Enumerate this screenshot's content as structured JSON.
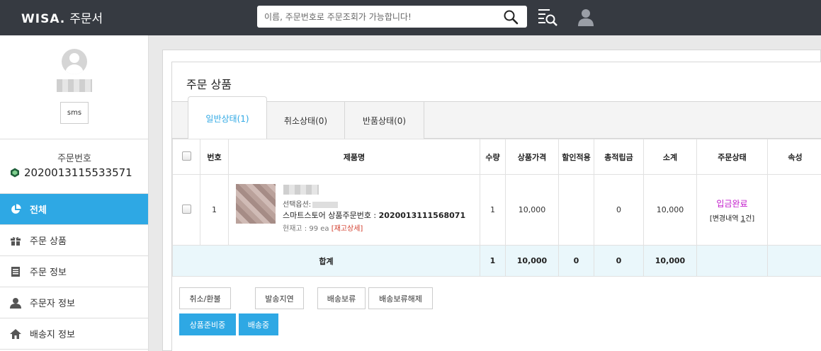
{
  "header": {
    "brand": "WISA.",
    "title": "주문서",
    "search_placeholder": "이름, 주문번호로 주문조회가 가능합니다!"
  },
  "sidebar": {
    "sms_label": "sms",
    "order_label": "주문번호",
    "order_number": "2020013115533571",
    "menu": [
      {
        "label": "전체",
        "icon": "pie-chart-icon",
        "active": true
      },
      {
        "label": "주문 상품",
        "icon": "gift-icon"
      },
      {
        "label": "주문 정보",
        "icon": "document-icon"
      },
      {
        "label": "주문자 정보",
        "icon": "person-icon"
      },
      {
        "label": "배송지 정보",
        "icon": "home-icon"
      }
    ]
  },
  "panel": {
    "title": "주문 상품",
    "tabs": [
      "일반상태(1)",
      "취소상태(0)",
      "반품상태(0)"
    ],
    "columns": [
      "번호",
      "제품명",
      "수량",
      "상품가격",
      "할인적용",
      "총적립금",
      "소계",
      "주문상태",
      "속성"
    ],
    "row": {
      "no": "1",
      "option_label": "선택옵션:",
      "store_label": "스마트스토어 상품주문번호 :",
      "store_order_no": "2020013111568071",
      "stock": "현재고 : 99 ea",
      "stock_link": "[재고상세]",
      "qty": "1",
      "price": "10,000",
      "discount": "",
      "points": "0",
      "subtotal": "10,000",
      "status": "입금완료",
      "status_detail_prefix": "[변경내역 ",
      "status_detail_count": "1",
      "status_detail_suffix": "건]",
      "attr": ""
    },
    "total": {
      "label": "합계",
      "qty": "1",
      "price": "10,000",
      "discount": "0",
      "points": "0",
      "subtotal": "10,000"
    },
    "buttons": {
      "cancel_refund": "취소/환불",
      "delay": "발송지연",
      "hold": "배송보류",
      "release_hold": "배송보류해제",
      "preparing": "상품준비중",
      "shipping": "배송중"
    }
  },
  "colors": {
    "topbar": "#363a41",
    "accent": "#2ea8e4",
    "status": "#c21acb"
  }
}
